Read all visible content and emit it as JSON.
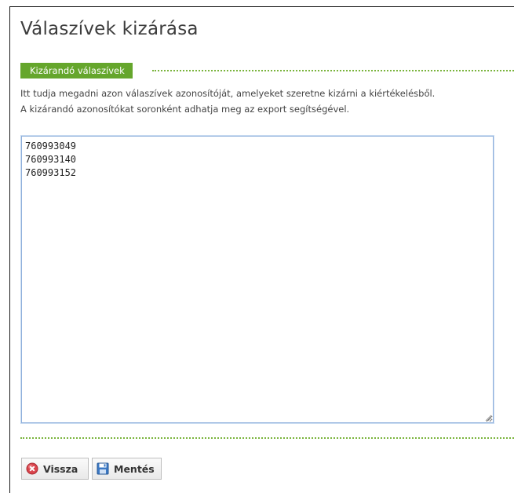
{
  "page": {
    "title": "Válaszívek kizárása"
  },
  "section": {
    "label": "Kizárandó válaszívek",
    "help_lines": [
      "Itt tudja megadni azon válaszívek azonosítóját, amelyeket szeretne kizárni a kiértékelésből.",
      "A kizárandó azonosítókat soronként adhatja meg az export segítségével."
    ]
  },
  "excluded_ids": {
    "value": "760993049\n760993140\n760993152"
  },
  "buttons": {
    "back_label": "Vissza",
    "back_icon": "cancel-icon",
    "save_label": "Mentés",
    "save_icon": "save-icon"
  },
  "colors": {
    "accent_green": "#65a62c",
    "textarea_focus": "#8fb0dc"
  }
}
